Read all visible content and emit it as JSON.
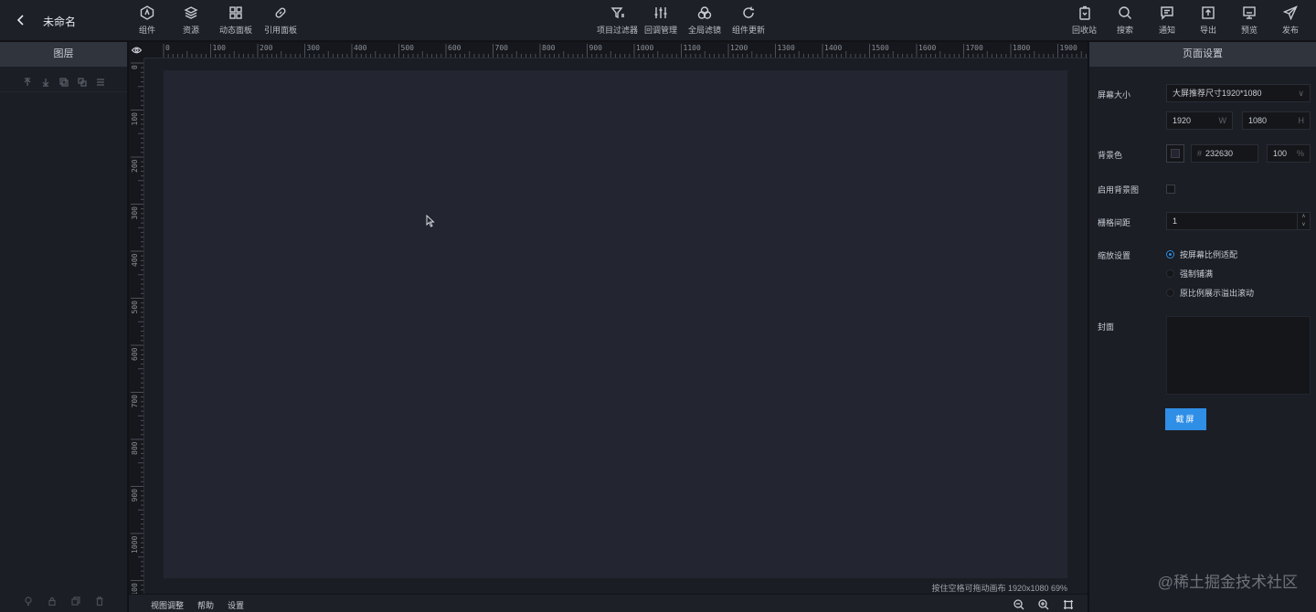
{
  "header": {
    "title": "未命名",
    "center_tools": [
      {
        "icon": "filter-icon",
        "label": "项目过滤器"
      },
      {
        "icon": "sliders-icon",
        "label": "回调管理"
      },
      {
        "icon": "circles-icon",
        "label": "全局滤镜"
      },
      {
        "icon": "refresh-icon",
        "label": "组件更新"
      }
    ],
    "left_tools": [
      {
        "icon": "component-icon",
        "label": "组件"
      },
      {
        "icon": "layers-icon",
        "label": "资源"
      },
      {
        "icon": "grid-icon",
        "label": "动态面板"
      },
      {
        "icon": "link-icon",
        "label": "引用面板"
      }
    ],
    "right_tools": [
      {
        "icon": "trash-icon",
        "label": "回收站"
      },
      {
        "icon": "search-icon",
        "label": "搜索"
      },
      {
        "icon": "message-icon",
        "label": "通知"
      },
      {
        "icon": "export-icon",
        "label": "导出"
      },
      {
        "icon": "monitor-icon",
        "label": "预览"
      },
      {
        "icon": "send-icon",
        "label": "发布"
      }
    ]
  },
  "layers": {
    "title": "图层"
  },
  "ruler": {
    "h_labels": [
      "0",
      "100",
      "200",
      "300",
      "400",
      "500",
      "600",
      "700",
      "800",
      "900",
      "1000",
      "1100",
      "1200",
      "1300",
      "1400",
      "1500",
      "1600",
      "1700",
      "1800",
      "1900"
    ],
    "v_labels": [
      "0",
      "100",
      "200",
      "300",
      "400",
      "500",
      "600",
      "700",
      "800",
      "900",
      "1000",
      "1100"
    ]
  },
  "canvas": {
    "status": "按住空格可拖动画布   1920x1080 69%"
  },
  "bottom": {
    "view": "视图调整",
    "help": "帮助",
    "settings": "设置"
  },
  "page_settings": {
    "title": "页面设置",
    "screen_size_label": "屏幕大小",
    "screen_size_value": "大屏推荐尺寸1920*1080",
    "width": "1920",
    "width_suffix": "W",
    "height": "1080",
    "height_suffix": "H",
    "bg_color_label": "背景色",
    "bg_color_hex": "232630",
    "bg_color_prefix": "#",
    "bg_opacity": "100",
    "bg_opacity_suffix": "%",
    "enable_bg_image_label": "启用背景图",
    "grid_spacing_label": "栅格间距",
    "grid_spacing": "1",
    "scale_label": "缩放设置",
    "scale_options": [
      "按屏幕比例适配",
      "强制铺满",
      "原比例展示溢出滚动"
    ],
    "cover_label": "封面",
    "screenshot_button": "截屏"
  },
  "watermark": "@稀土掘金技术社区",
  "colors": {
    "accent": "#2f8ee6",
    "canvas_bg": "#232630",
    "panel_bg": "#1b1e25"
  }
}
